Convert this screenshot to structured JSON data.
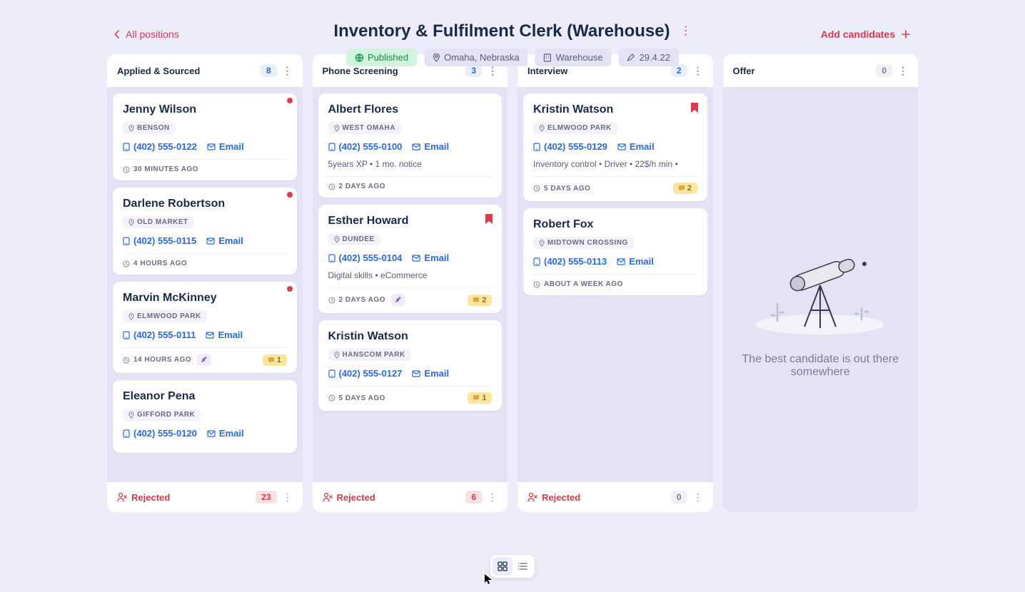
{
  "header": {
    "back_label": "All positions",
    "title": "Inventory & Fulfilment Clerk (Warehouse)",
    "status": "Published",
    "location": "Omaha, Nebraska",
    "department": "Warehouse",
    "date": "29.4.22",
    "add_label": "Add candidates"
  },
  "columns": [
    {
      "title": "Applied & Sourced",
      "count": "8",
      "rejected_count": "23",
      "cards": [
        {
          "name": "Jenny Wilson",
          "location": "BENSON",
          "phone": "(402) 555-0122",
          "email": "Email",
          "time": "30 MINUTES AGO",
          "red_dot": true
        },
        {
          "name": "Darlene Robertson",
          "location": "OLD MARKET",
          "phone": "(402) 555-0115",
          "email": "Email",
          "time": "4 HOURS AGO",
          "red_dot": true
        },
        {
          "name": "Marvin McKinney",
          "location": "ELMWOOD PARK",
          "phone": "(402) 555-0111",
          "email": "Email",
          "time": "14 HOURS AGO",
          "red_dot": true,
          "pin": true,
          "comment_count": "1"
        },
        {
          "name": "Eleanor Pena",
          "location": "GIFFORD PARK",
          "phone": "(402) 555-0120",
          "email": "Email",
          "time": ""
        }
      ]
    },
    {
      "title": "Phone Screening",
      "count": "3",
      "rejected_count": "6",
      "cards": [
        {
          "name": "Albert Flores",
          "location": "WEST OMAHA",
          "phone": "(402) 555-0100",
          "email": "Email",
          "notes": "5years XP • 1 mo. notice",
          "time": "2 DAYS AGO"
        },
        {
          "name": "Esther Howard",
          "location": "DUNDEE",
          "phone": "(402) 555-0104",
          "email": "Email",
          "notes": "Digital skills • eCommerce",
          "time": "2 DAYS AGO",
          "bookmark": true,
          "pin": true,
          "comment_count": "2"
        },
        {
          "name": "Kristin Watson",
          "location": "HANSCOM PARK",
          "phone": "(402) 555-0127",
          "email": "Email",
          "time": "5 DAYS AGO",
          "comment_count": "1"
        }
      ]
    },
    {
      "title": "Interview",
      "count": "2",
      "rejected_count": "0",
      "cards": [
        {
          "name": "Kristin Watson",
          "location": "ELMWOOD PARK",
          "phone": "(402) 555-0129",
          "email": "Email",
          "notes": "Inventory control • Driver • 22$/h min •",
          "time": "5 DAYS AGO",
          "bookmark": true,
          "comment_count": "2"
        },
        {
          "name": "Robert Fox",
          "location": "MIDTOWN CROSSING",
          "phone": "(402) 555-0113",
          "email": "Email",
          "time": "ABOUT A WEEK AGO"
        }
      ]
    },
    {
      "title": "Offer",
      "count": "0",
      "empty_text": "The best candidate is out there somewhere"
    }
  ],
  "rejected_label": "Rejected"
}
